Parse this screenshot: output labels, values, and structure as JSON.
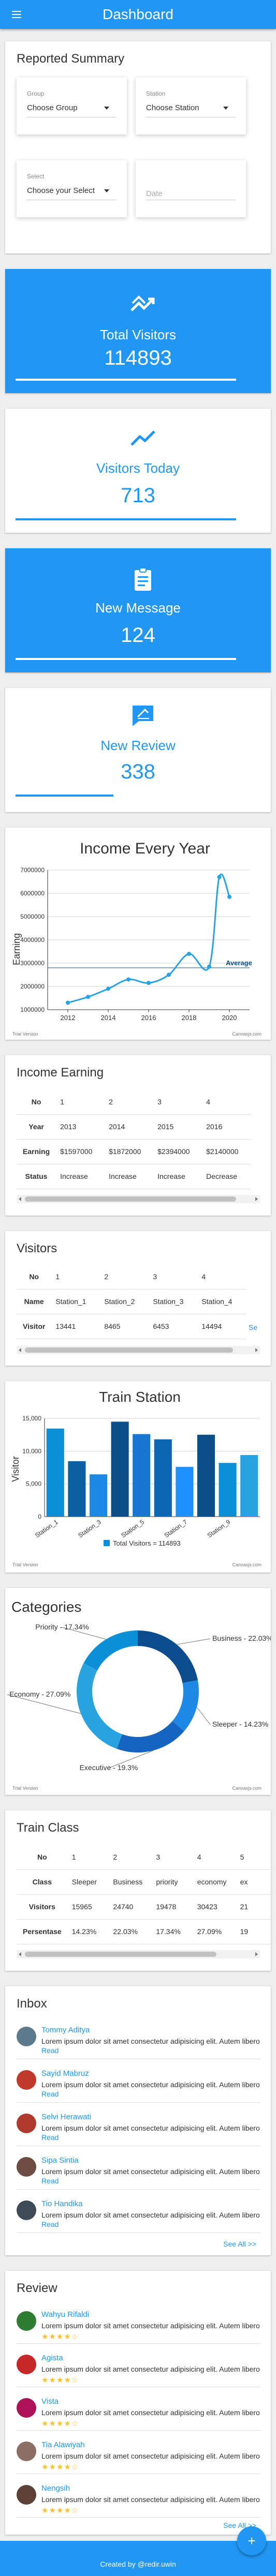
{
  "header": {
    "title": "Dashboard",
    "menu_icon": "hamburger-menu-icon"
  },
  "reported_summary": {
    "title": "Reported Summary",
    "group": {
      "label": "Group",
      "value": "Choose Group"
    },
    "station": {
      "label": "Station",
      "value": "Choose Station"
    },
    "select": {
      "label": "Select",
      "value": "Choose your Select"
    },
    "date": {
      "placeholder": "Date"
    }
  },
  "stats": {
    "total_visitors": {
      "label": "Total Visitors",
      "value": "114893",
      "icon": "trending-icon",
      "progress": 0.9
    },
    "visitors_today": {
      "label": "Visitors Today",
      "value": "713",
      "icon": "line-trend-icon",
      "progress": 0.9
    },
    "new_message": {
      "label": "New Message",
      "value": "124",
      "icon": "clipboard-icon",
      "progress": 0.9
    },
    "new_review": {
      "label": "New Review",
      "value": "338",
      "icon": "review-chat-icon",
      "progress": 0.4
    }
  },
  "charts": {
    "income": {
      "type": "line",
      "title": "Income Every Year",
      "ylabel": "Earning",
      "x": [
        2012,
        2013,
        2014,
        2015,
        2016,
        2017,
        2018,
        2019,
        2019.5,
        2020
      ],
      "values": [
        1300000,
        1550000,
        1900000,
        2300000,
        2150000,
        2500000,
        3400000,
        2850000,
        6700000,
        5850000
      ],
      "xticks": [
        "2012",
        "2014",
        "2016",
        "2018",
        "2020"
      ],
      "yticks": [
        "1000000",
        "2000000",
        "3000000",
        "4000000",
        "5000000",
        "6000000",
        "7000000"
      ],
      "ylim": [
        1000000,
        7000000
      ],
      "xlim": [
        2011,
        2021
      ],
      "average_label": "Average",
      "average_value": 2800000,
      "color": "#29a3e0",
      "footer_left": "Trial Version",
      "footer_right": "Canvasjs.com"
    },
    "train": {
      "type": "bar",
      "title": "Train Station",
      "ylabel": "Visitor",
      "yticks": [
        "0",
        "5,000",
        "10,000",
        "15,000"
      ],
      "ylim": [
        0,
        15000
      ],
      "values": [
        13441,
        8465,
        6453,
        14494,
        12600,
        11800,
        7600,
        12500,
        8200,
        9400
      ],
      "colors": [
        "#0d8fd8",
        "#0a5fa3",
        "#1e88e5",
        "#0a4f8a",
        "#1976d2",
        "#0d66b5",
        "#1e90ff",
        "#0a4f8a",
        "#0d8fd8",
        "#29a3e0"
      ],
      "xlabels": [
        "Station_1",
        "Station_3",
        "Station_5",
        "Station_7",
        "Station_9"
      ],
      "xlabel_positions": [
        0,
        2,
        4,
        6,
        8
      ],
      "legend": "Total Visitors = 114893",
      "footer_left": "Trial Version",
      "footer_right": "Canvasjs.com"
    },
    "categories": {
      "type": "pie",
      "title": "Categories",
      "labels": [
        "Business",
        "Sleeper",
        "Executive",
        "Economy",
        "Priority"
      ],
      "values": [
        22.03,
        14.23,
        19.3,
        27.09,
        17.34
      ],
      "colors": [
        "#0b4c8c",
        "#1e88e5",
        "#1565c0",
        "#29a3e0",
        "#0d8fd8"
      ],
      "label_texts": [
        "Business - 22.03%",
        "Sleeper - 14.23%",
        "Executive - 19.3%",
        "Economy - 27.09%",
        "Priority - 17.34%"
      ],
      "footer_left": "Trial Version",
      "footer_right": "Canvasjs.com"
    }
  },
  "income_table": {
    "title": "Income Earning",
    "rows": [
      {
        "head": "No",
        "cells": [
          "1",
          "2",
          "3",
          "4"
        ]
      },
      {
        "head": "Year",
        "cells": [
          "2013",
          "2014",
          "2015",
          "2016"
        ]
      },
      {
        "head": "Earning",
        "cells": [
          "$1597000",
          "$1872000",
          "$2394000",
          "$2140000"
        ]
      },
      {
        "head": "Status",
        "cells": [
          "Increase",
          "Increase",
          "Increase",
          "Decrease"
        ]
      }
    ]
  },
  "visitors_table": {
    "title": "Visitors",
    "rows": [
      {
        "head": "No",
        "cells": [
          "1",
          "2",
          "3",
          "4"
        ]
      },
      {
        "head": "Name",
        "cells": [
          "Station_1",
          "Station_2",
          "Station_3",
          "Station_4"
        ]
      },
      {
        "head": "Visitor",
        "cells": [
          "13441",
          "8465",
          "6453",
          "14494"
        ]
      }
    ],
    "see_link": "Se"
  },
  "trainclass_table": {
    "title": "Train Class",
    "rows": [
      {
        "head": "No",
        "cells": [
          "1",
          "2",
          "3",
          "4",
          "5"
        ]
      },
      {
        "head": "Class",
        "cells": [
          "Sleeper",
          "Business",
          "priority",
          "economy",
          "ex"
        ]
      },
      {
        "head": "Visitors",
        "cells": [
          "15965",
          "24740",
          "19478",
          "30423",
          "21"
        ]
      },
      {
        "head": "Persentase",
        "cells": [
          "14.23%",
          "22.03%",
          "17.34%",
          "27.09%",
          "19"
        ]
      }
    ]
  },
  "inbox": {
    "title": "Inbox",
    "see_all": "See All >>",
    "read_label": "Read",
    "items": [
      {
        "name": "Tommy Aditya",
        "message": "Lorem ipsum dolor sit amet consectetur adipisicing elit. Autem libero",
        "color": "#5d7a8c"
      },
      {
        "name": "Sayid Mabruz",
        "message": "Lorem ipsum dolor sit amet consectetur adipisicing elit. Autem libero",
        "color": "#c0392b"
      },
      {
        "name": "Selvi Herawati",
        "message": "Lorem ipsum dolor sit amet consectetur adipisicing elit. Autem libero",
        "color": "#b03a2e"
      },
      {
        "name": "Sipa Sintia",
        "message": "Lorem ipsum dolor sit amet consectetur adipisicing elit. Autem libero",
        "color": "#6d4c41"
      },
      {
        "name": "Tio Handika",
        "message": "Lorem ipsum dolor sit amet consectetur adipisicing elit. Autem libero",
        "color": "#3e4a56"
      }
    ]
  },
  "review": {
    "title": "Review",
    "see_all": "See All >>",
    "items": [
      {
        "name": "Wahyu Rifaldi",
        "message": "Lorem ipsum dolor sit amet consectetur adipisicing elit. Autem libero",
        "stars": "★★★★☆",
        "color": "#2e7d32"
      },
      {
        "name": "Agista",
        "message": "Lorem ipsum dolor sit amet consectetur adipisicing elit. Autem libero",
        "stars": "★★★★☆",
        "color": "#c62828"
      },
      {
        "name": "Vista",
        "message": "Lorem ipsum dolor sit amet consectetur adipisicing elit. Autem libero",
        "stars": "★★★★☆",
        "color": "#ad1457"
      },
      {
        "name": "Tia Alawiyah",
        "message": "Lorem ipsum dolor sit amet consectetur adipisicing elit. Autem libero",
        "stars": "★★★★☆",
        "color": "#8d6e63"
      },
      {
        "name": "Nengsih",
        "message": "Lorem ipsum dolor sit amet consectetur adipisicing elit. Autem libero",
        "stars": "★★★★☆",
        "color": "#5d4037"
      }
    ]
  },
  "footer": {
    "text": "Created by @redir.uwin",
    "fab_label": "+"
  }
}
